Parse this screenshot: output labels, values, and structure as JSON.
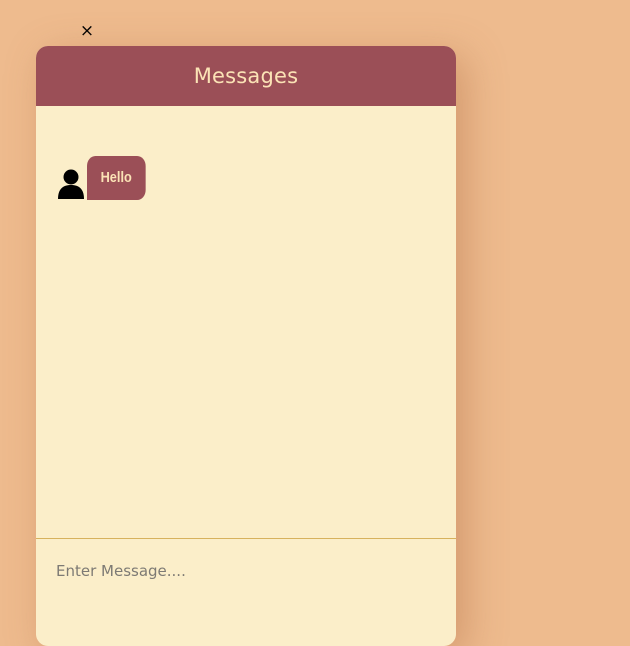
{
  "close_button": {
    "label": "×"
  },
  "header": {
    "title": "Messages"
  },
  "messages": [
    {
      "sender_icon": "user-icon",
      "text": "Hello"
    }
  ],
  "composer": {
    "placeholder": "Enter Message....",
    "value": ""
  },
  "colors": {
    "background": "#eebb8e",
    "header": "#9b4f57",
    "panel": "#fbeec9",
    "header_text": "#fbe3b6",
    "divider": "#d7b25d"
  }
}
